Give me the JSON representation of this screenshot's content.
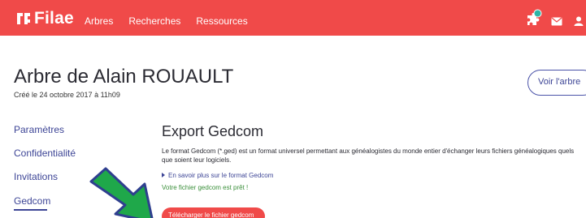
{
  "brand": {
    "name": "Filae"
  },
  "nav": {
    "items": [
      "Arbres",
      "Recherches",
      "Ressources"
    ]
  },
  "header_icons": [
    "puzzle-icon",
    "notification-dot-icon",
    "mail-icon",
    "user-icon"
  ],
  "tree": {
    "title": "Arbre de Alain ROUAULT",
    "created": "Créé le 24 octobre 2017 à 11h09",
    "view_button": "Voir l'arbre"
  },
  "sidebar": {
    "items": [
      "Paramètres",
      "Confidentialité",
      "Invitations",
      "Gedcom"
    ],
    "active": "Gedcom"
  },
  "export": {
    "title": "Export Gedcom",
    "description": "Le format Gedcom (*.ged) est un format universel permettant aux généalogistes du monde entier d'échanger leurs fichiers généalogiques quels que soient leur logiciels.",
    "more_link": "En savoir plus sur le format Gedcom",
    "status": "Votre fichier gedcom est prêt !",
    "download_button": "Télécharger le fichier gedcom"
  },
  "colors": {
    "brand_red": "#f04a49",
    "link_blue": "#3d4596",
    "success_green": "#3a8f3a",
    "notification_teal": "#2bb5a6",
    "arrow_green": "#1fa84a",
    "arrow_outline": "#2f3f8f"
  }
}
